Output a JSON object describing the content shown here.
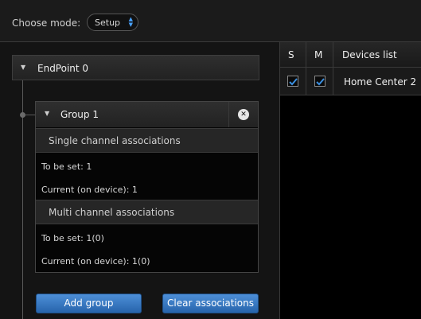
{
  "topbar": {
    "mode_label": "Choose mode:",
    "mode_value": "Setup"
  },
  "endpoint": {
    "title": "EndPoint 0"
  },
  "group": {
    "title": "Group 1",
    "single": {
      "header": "Single channel associations",
      "to_be_set": "To be set: 1",
      "current": "Current (on device): 1"
    },
    "multi": {
      "header": "Multi channel associations",
      "to_be_set": "To be set: 1(0)",
      "current": "Current (on device): 1(0)"
    }
  },
  "buttons": {
    "add_group": "Add group",
    "clear_associations": "Clear associations"
  },
  "devices": {
    "col_s": "S",
    "col_m": "M",
    "col_title": "Devices list",
    "rows": [
      {
        "name": "Home Center 2",
        "s_checked": true,
        "m_checked": true
      }
    ]
  },
  "colors": {
    "accent": "#3a8fe0",
    "button": "#3a7cc4"
  }
}
